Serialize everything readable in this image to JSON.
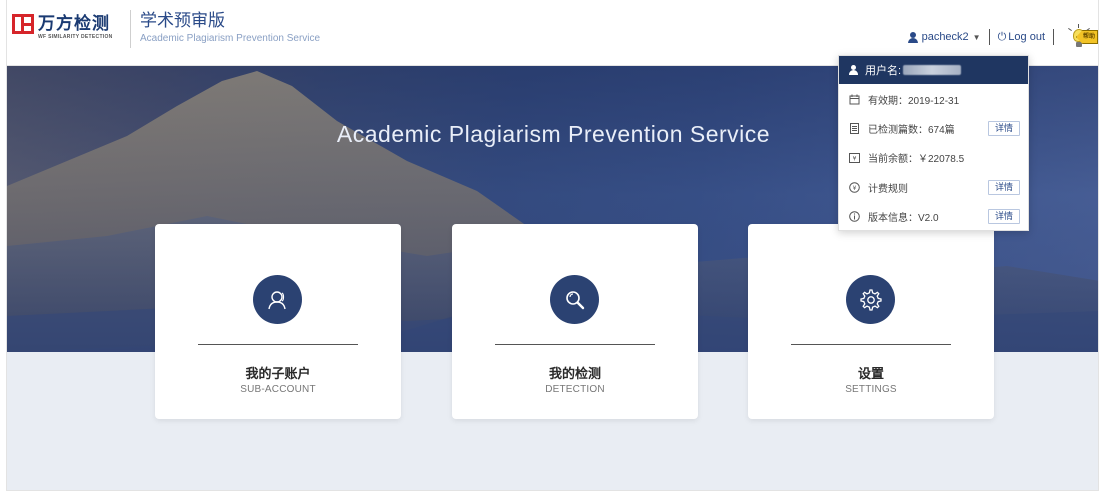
{
  "brand": {
    "logo_cn": "万方检测",
    "logo_en": "WF SIMILARITY DETECTION",
    "product_cn": "学术预审版",
    "product_en": "Academic Plagiarism Prevention Service"
  },
  "header": {
    "username": "pacheck2",
    "logout_label": "Log out",
    "tip_tag": "帮助"
  },
  "hero": {
    "title": "Academic Plagiarism Prevention Service"
  },
  "cards": [
    {
      "title": "我的子账户",
      "subtitle": "SUB-ACCOUNT",
      "icon": "user-icon"
    },
    {
      "title": "我的检测",
      "subtitle": "DETECTION",
      "icon": "magnifier-icon"
    },
    {
      "title": "设置",
      "subtitle": "SETTINGS",
      "icon": "gear-icon"
    }
  ],
  "dropdown": {
    "username_label": "用户名:",
    "validity": "有效期：2019-12-31",
    "checked_count": "已检测篇数：674篇",
    "balance": "当前余额：￥22078.5",
    "billing_rules": "计费规则",
    "version": "版本信息：V2.0",
    "detail_label": "详情"
  },
  "colors": {
    "brand_red": "#d6252a",
    "brand_navy": "#1f3661",
    "card_icon_bg": "#2b4272"
  }
}
